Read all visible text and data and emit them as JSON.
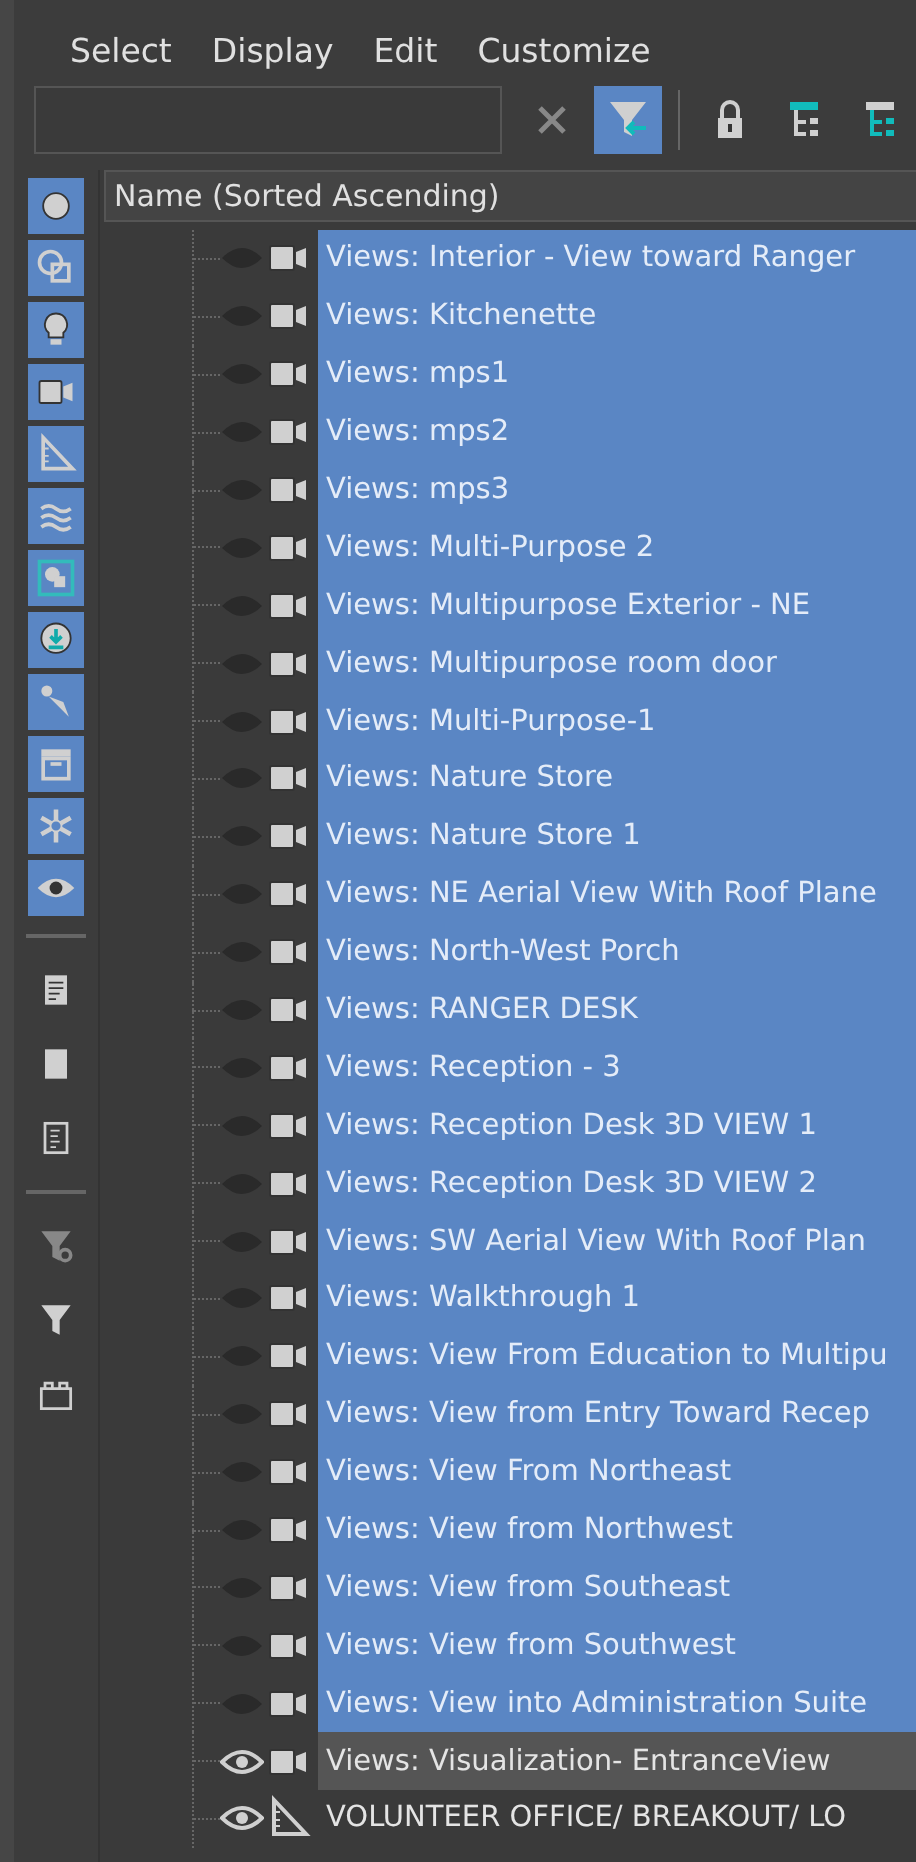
{
  "menu": [
    "Select",
    "Display",
    "Edit",
    "Customize"
  ],
  "toolbar": [
    {
      "kind": "clear",
      "selected": false
    },
    {
      "kind": "filter",
      "selected": true
    },
    {
      "kind": "lock",
      "selected": false
    },
    {
      "kind": "hierarchy",
      "selected": false
    },
    {
      "kind": "hierarchy-teal",
      "selected": false
    }
  ],
  "sidebar": [
    {
      "kind": "geometry",
      "selected": true
    },
    {
      "kind": "shapes",
      "selected": true
    },
    {
      "kind": "light",
      "selected": true
    },
    {
      "kind": "camera",
      "selected": true
    },
    {
      "kind": "helper",
      "selected": true
    },
    {
      "kind": "spacewarp",
      "selected": true
    },
    {
      "kind": "group",
      "selected": true
    },
    {
      "kind": "xref",
      "selected": true
    },
    {
      "kind": "bone",
      "selected": true
    },
    {
      "kind": "container",
      "selected": true
    },
    {
      "kind": "frozen",
      "selected": true
    },
    {
      "kind": "hidden",
      "selected": true
    },
    {
      "kind": "separator"
    },
    {
      "kind": "select-all",
      "selected": false
    },
    {
      "kind": "select-none",
      "selected": false
    },
    {
      "kind": "select-invert",
      "selected": false
    },
    {
      "kind": "separator"
    },
    {
      "kind": "filter-settings",
      "selected": false
    },
    {
      "kind": "filter",
      "selected": false
    },
    {
      "kind": "layers",
      "selected": false
    }
  ],
  "header": {
    "label": "Name (Sorted Ascending)"
  },
  "rows": [
    {
      "text": "Views: Interior - View toward Ranger",
      "kind": "camera",
      "visible": false,
      "selected": true,
      "hovered": false
    },
    {
      "text": "Views: Kitchenette",
      "kind": "camera",
      "visible": false,
      "selected": true,
      "hovered": false
    },
    {
      "text": "Views: mps1",
      "kind": "camera",
      "visible": false,
      "selected": true,
      "hovered": false
    },
    {
      "text": "Views: mps2",
      "kind": "camera",
      "visible": false,
      "selected": true,
      "hovered": false
    },
    {
      "text": "Views: mps3",
      "kind": "camera",
      "visible": false,
      "selected": true,
      "hovered": false
    },
    {
      "text": "Views: Multi-Purpose 2",
      "kind": "camera",
      "visible": false,
      "selected": true,
      "hovered": false
    },
    {
      "text": "Views: Multipurpose Exterior - NE",
      "kind": "camera",
      "visible": false,
      "selected": true,
      "hovered": false
    },
    {
      "text": "Views: Multipurpose room door",
      "kind": "camera",
      "visible": false,
      "selected": true,
      "hovered": false
    },
    {
      "text": "Views: Multi-Purpose-1",
      "kind": "camera",
      "visible": false,
      "selected": true,
      "hovered": false
    },
    {
      "text": "Views: Nature Store",
      "kind": "camera",
      "visible": false,
      "selected": true,
      "hovered": false
    },
    {
      "text": "Views: Nature Store 1",
      "kind": "camera",
      "visible": false,
      "selected": true,
      "hovered": false
    },
    {
      "text": "Views: NE Aerial View With Roof Plane",
      "kind": "camera",
      "visible": false,
      "selected": true,
      "hovered": false
    },
    {
      "text": "Views: North-West Porch",
      "kind": "camera",
      "visible": false,
      "selected": true,
      "hovered": false
    },
    {
      "text": "Views: RANGER DESK",
      "kind": "camera",
      "visible": false,
      "selected": true,
      "hovered": false
    },
    {
      "text": "Views: Reception - 3",
      "kind": "camera",
      "visible": false,
      "selected": true,
      "hovered": false
    },
    {
      "text": "Views: Reception Desk 3D VIEW 1",
      "kind": "camera",
      "visible": false,
      "selected": true,
      "hovered": false
    },
    {
      "text": "Views: Reception Desk 3D VIEW 2",
      "kind": "camera",
      "visible": false,
      "selected": true,
      "hovered": false
    },
    {
      "text": "Views: SW Aerial View With Roof Plan",
      "kind": "camera",
      "visible": false,
      "selected": true,
      "hovered": false
    },
    {
      "text": "Views: Walkthrough 1",
      "kind": "camera",
      "visible": false,
      "selected": true,
      "hovered": false
    },
    {
      "text": "Views: View From Education to Multipu",
      "kind": "camera",
      "visible": false,
      "selected": true,
      "hovered": false
    },
    {
      "text": "Views: View from Entry Toward Recep",
      "kind": "camera",
      "visible": false,
      "selected": true,
      "hovered": false
    },
    {
      "text": "Views: View From Northeast",
      "kind": "camera",
      "visible": false,
      "selected": true,
      "hovered": false
    },
    {
      "text": "Views: View from Northwest",
      "kind": "camera",
      "visible": false,
      "selected": true,
      "hovered": false
    },
    {
      "text": "Views: View from Southeast",
      "kind": "camera",
      "visible": false,
      "selected": true,
      "hovered": false
    },
    {
      "text": "Views: View from Southwest",
      "kind": "camera",
      "visible": false,
      "selected": true,
      "hovered": false
    },
    {
      "text": "Views: View into Administration Suite",
      "kind": "camera",
      "visible": false,
      "selected": true,
      "hovered": false
    },
    {
      "text": "Views: Visualization- EntranceView",
      "kind": "camera",
      "visible": true,
      "selected": false,
      "hovered": true
    },
    {
      "text": "VOLUNTEER OFFICE/ BREAKOUT/ LO",
      "kind": "helper",
      "visible": true,
      "selected": false,
      "hovered": false
    }
  ]
}
